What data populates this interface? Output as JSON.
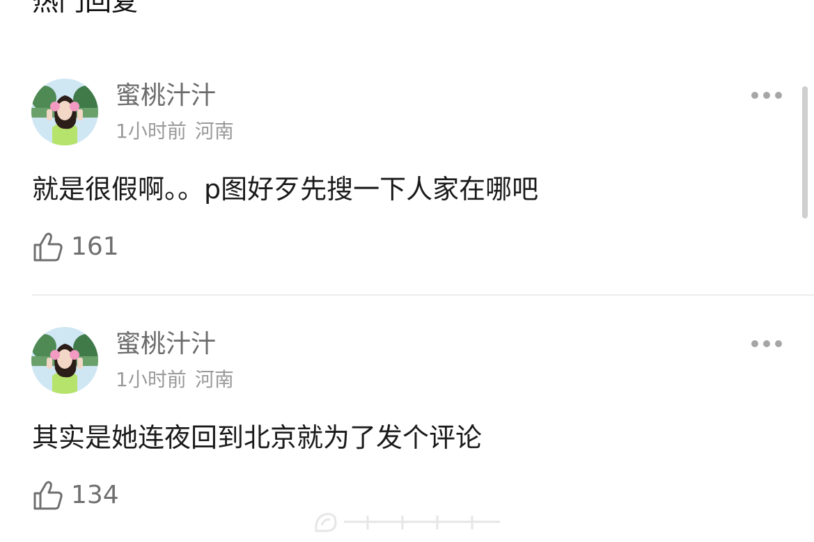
{
  "section": {
    "title": "热门回复"
  },
  "comments": [
    {
      "username": "蜜桃汁汁",
      "time": "1小时前",
      "location": "河南",
      "text": "就是很假啊。。p图好歹先搜一下人家在哪吧",
      "likes": "161"
    },
    {
      "username": "蜜桃汁汁",
      "time": "1小时前",
      "location": "河南",
      "text": "其实是她连夜回到北京就为了发个评论",
      "likes": "134"
    }
  ],
  "icons": {
    "more": "more-dots-icon",
    "like": "thumbs-up-icon"
  },
  "colors": {
    "username": "#6b6b6b",
    "meta": "#9a9a9a",
    "text": "#1a1a1a",
    "divider": "#ececec"
  }
}
